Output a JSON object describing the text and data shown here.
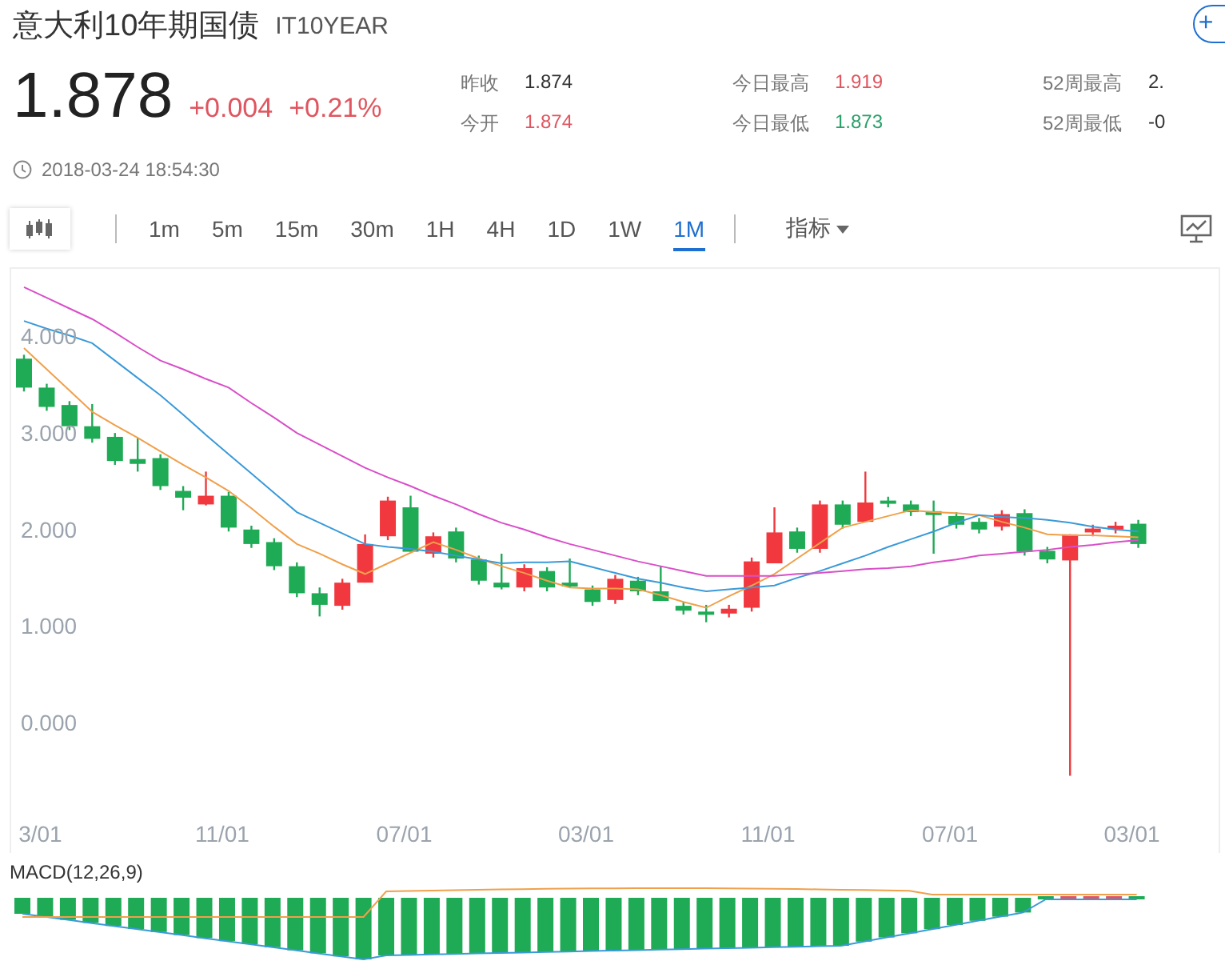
{
  "header": {
    "title": "意大利10年期国债",
    "symbol": "IT10YEAR",
    "add_button": "+"
  },
  "quote": {
    "price": "1.878",
    "change": "+0.004",
    "change_pct": "+0.21%",
    "timestamp": "2018-03-24 18:54:30"
  },
  "stats": [
    {
      "label": "昨收",
      "value": "1.874",
      "color": "#333333"
    },
    {
      "label": "今开",
      "value": "1.874",
      "color": "#e0555f"
    },
    {
      "label": "今日最高",
      "value": "1.919",
      "color": "#e0555f"
    },
    {
      "label": "今日最低",
      "value": "1.873",
      "color": "#2aa06a"
    },
    {
      "label": "52周最高",
      "value": "2.",
      "color": "#333333"
    },
    {
      "label": "52周最低",
      "value": "-0",
      "color": "#333333"
    }
  ],
  "toolbar": {
    "periods": [
      {
        "label": "1m",
        "selected": false
      },
      {
        "label": "5m",
        "selected": false
      },
      {
        "label": "15m",
        "selected": false
      },
      {
        "label": "30m",
        "selected": false
      },
      {
        "label": "1H",
        "selected": false
      },
      {
        "label": "4H",
        "selected": false
      },
      {
        "label": "1D",
        "selected": false
      },
      {
        "label": "1W",
        "selected": false
      },
      {
        "label": "1M",
        "selected": true
      }
    ],
    "indicator": "指标"
  },
  "price_chart": {
    "chart_data": {
      "type": "candlestick",
      "categories": [
        null,
        "3/01",
        null,
        null,
        null,
        null,
        null,
        null,
        null,
        "11/01",
        null,
        null,
        null,
        null,
        null,
        null,
        null,
        "07/01",
        null,
        null,
        null,
        null,
        null,
        null,
        null,
        "03/01",
        null,
        null,
        null,
        null,
        null,
        null,
        null,
        "11/01",
        null,
        null,
        null,
        null,
        null,
        null,
        null,
        "07/01",
        null,
        null,
        null,
        null,
        null,
        null,
        null,
        "03/01"
      ],
      "ylim": [
        -1.35,
        4.7
      ],
      "yticks": [
        {
          "value": 0,
          "label": "0.000"
        },
        {
          "value": 1,
          "label": "1.000"
        },
        {
          "value": 2,
          "label": "2.000"
        },
        {
          "value": 3,
          "label": "3.000"
        },
        {
          "value": 4,
          "label": "4.000"
        }
      ],
      "ohlc": [
        [
          3.77,
          3.81,
          3.43,
          3.47
        ],
        [
          3.47,
          3.51,
          3.23,
          3.27
        ],
        [
          3.29,
          3.33,
          3.03,
          3.07
        ],
        [
          3.07,
          3.3,
          2.9,
          2.94
        ],
        [
          2.96,
          3.0,
          2.67,
          2.71
        ],
        [
          2.73,
          2.95,
          2.6,
          2.68
        ],
        [
          2.74,
          2.78,
          2.41,
          2.45
        ],
        [
          2.4,
          2.45,
          2.2,
          2.33
        ],
        [
          2.26,
          2.6,
          2.25,
          2.35
        ],
        [
          2.35,
          2.39,
          1.98,
          2.02
        ],
        [
          2.0,
          2.04,
          1.81,
          1.85
        ],
        [
          1.87,
          1.91,
          1.58,
          1.62
        ],
        [
          1.62,
          1.66,
          1.3,
          1.34
        ],
        [
          1.34,
          1.4,
          1.1,
          1.22
        ],
        [
          1.21,
          1.49,
          1.17,
          1.45
        ],
        [
          1.45,
          1.95,
          1.45,
          1.85
        ],
        [
          1.93,
          2.34,
          1.89,
          2.3
        ],
        [
          2.23,
          2.35,
          1.77,
          1.77
        ],
        [
          1.75,
          1.97,
          1.71,
          1.93
        ],
        [
          1.98,
          2.02,
          1.66,
          1.7
        ],
        [
          1.69,
          1.73,
          1.43,
          1.47
        ],
        [
          1.45,
          1.75,
          1.38,
          1.4
        ],
        [
          1.4,
          1.64,
          1.36,
          1.6
        ],
        [
          1.57,
          1.61,
          1.36,
          1.4
        ],
        [
          1.45,
          1.7,
          1.4,
          1.41
        ],
        [
          1.38,
          1.42,
          1.21,
          1.25
        ],
        [
          1.27,
          1.53,
          1.23,
          1.49
        ],
        [
          1.47,
          1.51,
          1.32,
          1.36
        ],
        [
          1.36,
          1.62,
          1.26,
          1.26
        ],
        [
          1.21,
          1.25,
          1.12,
          1.16
        ],
        [
          1.15,
          1.22,
          1.04,
          1.12
        ],
        [
          1.13,
          1.22,
          1.09,
          1.18
        ],
        [
          1.19,
          1.71,
          1.15,
          1.67
        ],
        [
          1.65,
          2.23,
          1.65,
          1.97
        ],
        [
          1.98,
          2.02,
          1.76,
          1.8
        ],
        [
          1.8,
          2.3,
          1.76,
          2.26
        ],
        [
          2.26,
          2.3,
          2.01,
          2.05
        ],
        [
          2.08,
          2.6,
          2.08,
          2.28
        ],
        [
          2.3,
          2.34,
          2.23,
          2.27
        ],
        [
          2.26,
          2.3,
          2.14,
          2.18
        ],
        [
          2.19,
          2.3,
          1.75,
          2.15
        ],
        [
          2.14,
          2.18,
          2.01,
          2.05
        ],
        [
          2.08,
          2.12,
          1.96,
          2.0
        ],
        [
          2.03,
          2.2,
          1.99,
          2.16
        ],
        [
          2.17,
          2.21,
          1.73,
          1.77
        ],
        [
          1.78,
          1.82,
          1.65,
          1.69
        ],
        [
          1.68,
          1.95,
          -0.55,
          1.95
        ],
        [
          1.97,
          2.05,
          1.93,
          2.01
        ],
        [
          2.0,
          2.08,
          1.96,
          2.04
        ],
        [
          2.06,
          2.1,
          1.81,
          1.85
        ]
      ],
      "series": [
        {
          "type": "line",
          "color": "#f0a04b",
          "values": [
            3.88,
            3.66,
            3.44,
            3.22,
            3.08,
            2.95,
            2.81,
            2.67,
            2.54,
            2.4,
            2.22,
            2.03,
            1.85,
            1.75,
            1.64,
            1.54,
            1.65,
            1.76,
            1.87,
            1.79,
            1.7,
            1.62,
            1.55,
            1.47,
            1.4,
            1.39,
            1.39,
            1.38,
            1.32,
            1.25,
            1.19,
            1.31,
            1.42,
            1.54,
            1.7,
            1.86,
            2.02,
            2.08,
            2.14,
            2.2,
            2.18,
            2.17,
            2.15,
            2.08,
            2.02,
            1.95,
            1.94,
            1.94,
            1.93,
            1.92
          ]
        },
        {
          "type": "line",
          "color": "#3a9ad9",
          "values": [
            4.16,
            4.08,
            4.01,
            3.93,
            3.75,
            3.57,
            3.39,
            3.19,
            2.98,
            2.78,
            2.58,
            2.38,
            2.18,
            2.07,
            1.96,
            1.85,
            1.82,
            1.8,
            1.77,
            1.73,
            1.69,
            1.65,
            1.66,
            1.66,
            1.67,
            1.61,
            1.55,
            1.49,
            1.45,
            1.4,
            1.36,
            1.38,
            1.4,
            1.42,
            1.5,
            1.57,
            1.65,
            1.73,
            1.82,
            1.9,
            1.98,
            2.07,
            2.15,
            2.13,
            2.12,
            2.1,
            2.07,
            2.03,
            2.0,
            1.98
          ]
        },
        {
          "type": "line",
          "color": "#d94fc8",
          "values": [
            4.51,
            4.4,
            4.29,
            4.18,
            4.04,
            3.89,
            3.75,
            3.66,
            3.56,
            3.47,
            3.31,
            3.16,
            3.0,
            2.88,
            2.76,
            2.64,
            2.54,
            2.45,
            2.35,
            2.26,
            2.16,
            2.07,
            2.0,
            1.92,
            1.85,
            1.79,
            1.73,
            1.67,
            1.62,
            1.57,
            1.52,
            1.52,
            1.52,
            1.52,
            1.54,
            1.55,
            1.57,
            1.59,
            1.6,
            1.62,
            1.66,
            1.69,
            1.73,
            1.75,
            1.77,
            1.79,
            1.82,
            1.84,
            1.87,
            1.89
          ]
        }
      ]
    }
  },
  "macd": {
    "label": "MACD(12,26,9)"
  }
}
